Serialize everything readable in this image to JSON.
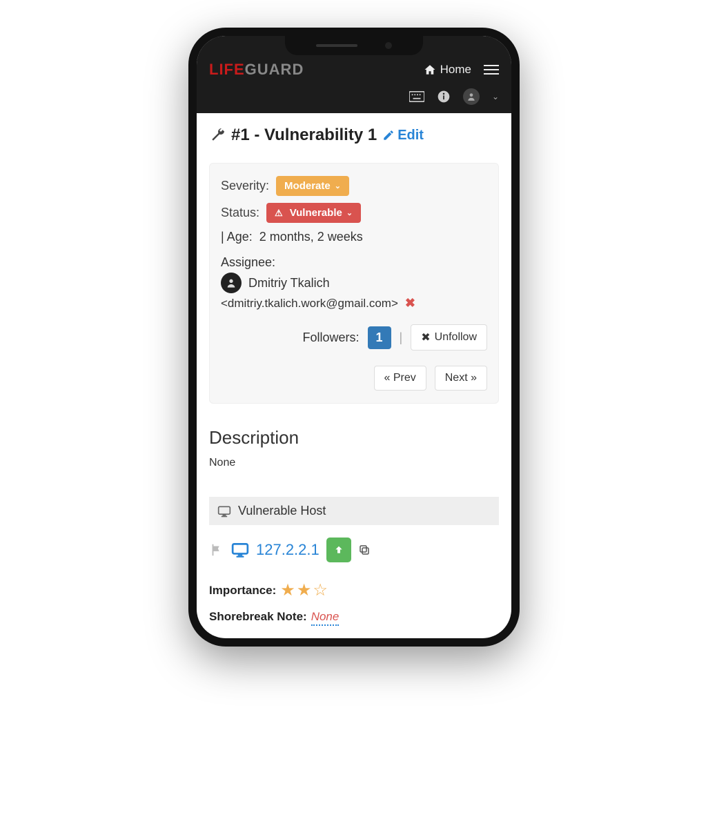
{
  "header": {
    "logo_life": "LIFE",
    "logo_guard": "GUARD",
    "home_label": "Home"
  },
  "page": {
    "title": "#1 - Vulnerability 1",
    "edit_label": "Edit"
  },
  "details": {
    "severity_label": "Severity:",
    "severity_value": "Moderate",
    "status_label": "Status:",
    "status_value": "Vulnerable",
    "age_label": "| Age:",
    "age_value": "2 months, 2 weeks",
    "assignee_label": "Assignee:",
    "assignee_name": "Dmitriy Tkalich",
    "assignee_email": "<dmitriy.tkalich.work@gmail.com>",
    "followers_label": "Followers:",
    "followers_count": "1",
    "unfollow_label": "Unfollow",
    "prev_label": "« Prev",
    "next_label": "Next »"
  },
  "description": {
    "heading": "Description",
    "body": "None"
  },
  "host": {
    "section_label": "Vulnerable Host",
    "ip": "127.2.2.1",
    "importance_label": "Importance:",
    "importance_stars_full": 2,
    "importance_stars_total": 3,
    "note_label": "Shorebreak Note:",
    "note_value": "None"
  }
}
